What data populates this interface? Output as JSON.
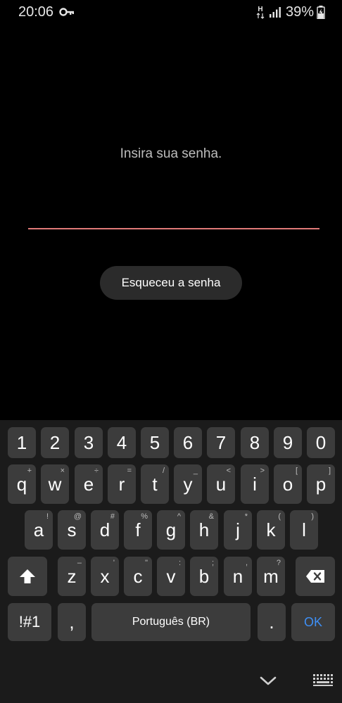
{
  "status_bar": {
    "time": "20:06",
    "network_label": "H",
    "battery_percent": "39%"
  },
  "lock": {
    "prompt": "Insira sua senha.",
    "password_value": "",
    "forgot_label": "Esqueceu a senha"
  },
  "keyboard": {
    "number_row": [
      "1",
      "2",
      "3",
      "4",
      "5",
      "6",
      "7",
      "8",
      "9",
      "0"
    ],
    "row1": [
      {
        "main": "q",
        "hint": "+"
      },
      {
        "main": "w",
        "hint": "×"
      },
      {
        "main": "e",
        "hint": "÷"
      },
      {
        "main": "r",
        "hint": "="
      },
      {
        "main": "t",
        "hint": "/"
      },
      {
        "main": "y",
        "hint": "_"
      },
      {
        "main": "u",
        "hint": "<"
      },
      {
        "main": "i",
        "hint": ">"
      },
      {
        "main": "o",
        "hint": "["
      },
      {
        "main": "p",
        "hint": "]"
      }
    ],
    "row2": [
      {
        "main": "a",
        "hint": "!"
      },
      {
        "main": "s",
        "hint": "@"
      },
      {
        "main": "d",
        "hint": "#"
      },
      {
        "main": "f",
        "hint": "%"
      },
      {
        "main": "g",
        "hint": "^"
      },
      {
        "main": "h",
        "hint": "&"
      },
      {
        "main": "j",
        "hint": "*"
      },
      {
        "main": "k",
        "hint": "("
      },
      {
        "main": "l",
        "hint": ")"
      }
    ],
    "row3": [
      {
        "main": "z",
        "hint": "–"
      },
      {
        "main": "x",
        "hint": "'"
      },
      {
        "main": "c",
        "hint": "\""
      },
      {
        "main": "v",
        "hint": ":"
      },
      {
        "main": "b",
        "hint": ";"
      },
      {
        "main": "n",
        "hint": ","
      },
      {
        "main": "m",
        "hint": "?"
      }
    ],
    "symbols_label": "!#1",
    "comma_label": ",",
    "space_label": "Português (BR)",
    "period_label": ".",
    "ok_label": "OK"
  },
  "colors": {
    "field_underline": "#e07a78",
    "ok_accent": "#3e8ff5",
    "key_bg": "#3c3c3c",
    "keyboard_bg": "#1b1b1b"
  }
}
